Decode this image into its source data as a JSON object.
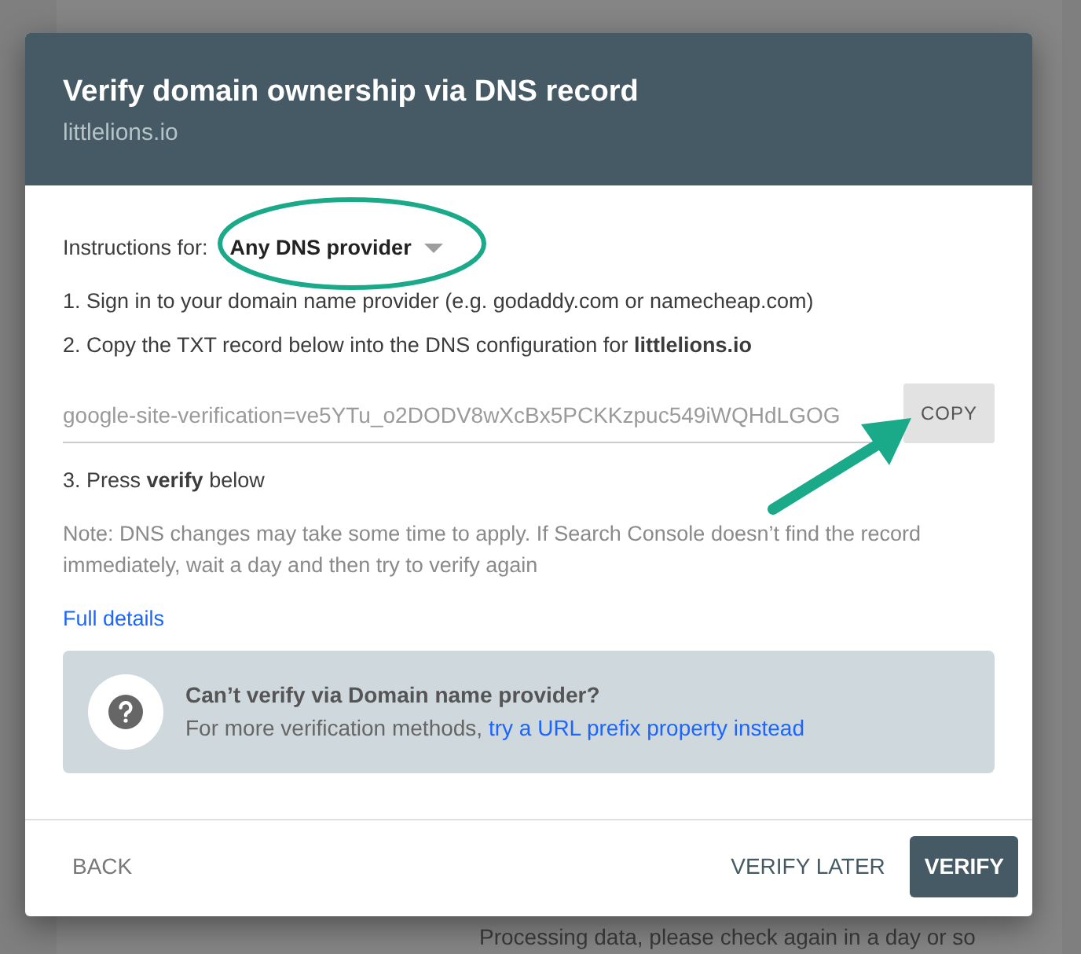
{
  "background": {
    "status_text": "Processing data, please check again in a day or so"
  },
  "dialog": {
    "title": "Verify domain ownership via DNS record",
    "subtitle": "littlelions.io",
    "instructions_label": "Instructions for:",
    "provider_select": {
      "value": "Any DNS provider"
    },
    "steps": [
      "1. Sign in to your domain name provider (e.g. godaddy.com or namecheap.com)",
      "2. Copy the TXT record below into the DNS configuration for **littlelions.io**"
    ],
    "txt_record": "google-site-verification=ve5YTu_o2DODV8wXcBx5PCKKzpuc549iWQHdLGOG",
    "copy_button": "COPY",
    "step_3": "3. Press **verify** below",
    "note": "Note: DNS changes may take some time to apply. If Search Console doesn’t find the record immediately, wait a day and then try to verify again",
    "details_link": "Full details",
    "help_box": {
      "title": "Can’t verify via Domain name provider?",
      "text": "For more verification methods, ",
      "link": "try a URL prefix property instead"
    },
    "buttons": [
      {
        "label": "BACK",
        "kind": "text"
      },
      {
        "label": "VERIFY LATER",
        "kind": "secondary"
      },
      {
        "label": "VERIFY",
        "kind": "primary"
      }
    ]
  }
}
